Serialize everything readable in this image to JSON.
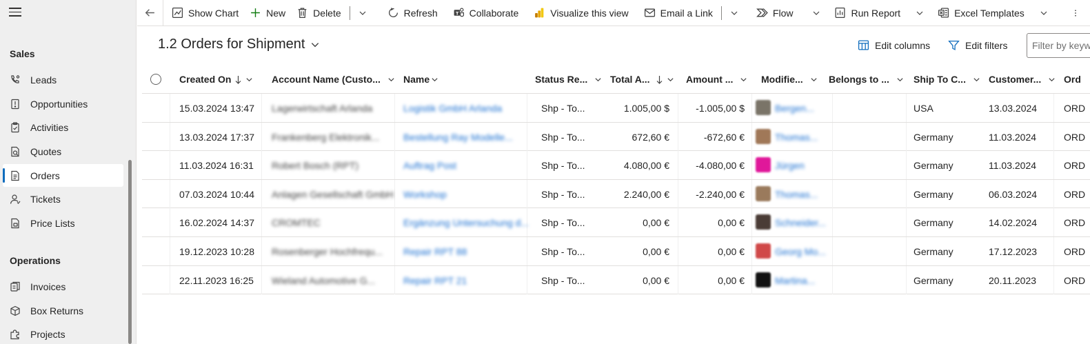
{
  "sidebar": {
    "sections": [
      {
        "title": "Sales",
        "items": [
          {
            "label": "Leads",
            "icon": "phone-person-icon"
          },
          {
            "label": "Opportunities",
            "icon": "opportunity-icon"
          },
          {
            "label": "Activities",
            "icon": "clipboard-icon"
          },
          {
            "label": "Quotes",
            "icon": "quote-icon"
          },
          {
            "label": "Orders",
            "icon": "order-icon",
            "active": true
          },
          {
            "label": "Tickets",
            "icon": "person-icon"
          },
          {
            "label": "Price Lists",
            "icon": "price-list-icon"
          }
        ]
      },
      {
        "title": "Operations",
        "items": [
          {
            "label": "Invoices",
            "icon": "invoice-icon"
          },
          {
            "label": "Box Returns",
            "icon": "box-icon"
          },
          {
            "label": "Projects",
            "icon": "puzzle-icon"
          }
        ]
      }
    ]
  },
  "toolbar": {
    "show_chart": "Show Chart",
    "new": "New",
    "delete": "Delete",
    "refresh": "Refresh",
    "collaborate": "Collaborate",
    "visualize": "Visualize this view",
    "email_link": "Email a Link",
    "flow": "Flow",
    "run_report": "Run Report",
    "excel_templates": "Excel Templates"
  },
  "view": {
    "title": "1.2 Orders for Shipment",
    "edit_columns": "Edit columns",
    "edit_filters": "Edit filters",
    "filter_placeholder": "Filter by keyword"
  },
  "columns": [
    {
      "label": "Created On",
      "sorted": "desc"
    },
    {
      "label": "Account Name (Custo..."
    },
    {
      "label": "Name"
    },
    {
      "label": "Status Re..."
    },
    {
      "label": "Total A...",
      "sorted": "desc"
    },
    {
      "label": "Amount ..."
    },
    {
      "label": "Modifie..."
    },
    {
      "label": "Belongs to ..."
    },
    {
      "label": "Ship To C..."
    },
    {
      "label": "Customer..."
    },
    {
      "label": "Ord"
    }
  ],
  "rows": [
    {
      "created": "15.03.2024 13:47",
      "account": "Lagerwirtschaft Arlanda",
      "name": "Logistik GmbH Arlanda",
      "status": "Shp - To...",
      "total": "1.005,00 $",
      "amount": "-1.005,00 $",
      "modified": "Bergen...",
      "avatar": "#7a7468",
      "ship_to": "USA",
      "customer_date": "13.03.2024",
      "order": "ORD"
    },
    {
      "created": "13.03.2024 17:37",
      "account": "Frankenberg Elektronik...",
      "name": "Bestellung Ray Modelle...",
      "status": "Shp - To...",
      "total": "672,60 €",
      "amount": "-672,60 €",
      "modified": "Thomas...",
      "avatar": "#a07858",
      "ship_to": "Germany",
      "customer_date": "11.03.2024",
      "order": "ORD"
    },
    {
      "created": "11.03.2024 16:31",
      "account": "Robert Bosch (RPT)",
      "name": "Auftrag Post",
      "status": "Shp - To...",
      "total": "4.080,00 €",
      "amount": "-4.080,00 €",
      "modified": "Jürgen",
      "avatar": "#e0189a",
      "ship_to": "Germany",
      "customer_date": "11.03.2024",
      "order": "ORD"
    },
    {
      "created": "07.03.2024 10:44",
      "account": "Anlagen Gesellschaft GmbH",
      "name": "Workshop",
      "status": "Shp - To...",
      "total": "2.240,00 €",
      "amount": "-2.240,00 €",
      "modified": "Thomas...",
      "avatar": "#9a7a5c",
      "ship_to": "Germany",
      "customer_date": "06.03.2024",
      "order": "ORD"
    },
    {
      "created": "16.02.2024 14:37",
      "account": "CROMTEC",
      "name": "Ergänzung Untersuchung d...",
      "status": "Shp - To...",
      "total": "0,00 €",
      "amount": "0,00 €",
      "modified": "Schneider...",
      "avatar": "#4a3c36",
      "ship_to": "Germany",
      "customer_date": "14.02.2024",
      "order": "ORD"
    },
    {
      "created": "19.12.2023 10:28",
      "account": "Rosenberger Hochfrequ...",
      "name": "Repair RPT 88",
      "status": "Shp - To...",
      "total": "0,00 €",
      "amount": "0,00 €",
      "modified": "Georg Mo...",
      "avatar": "#d04848",
      "ship_to": "Germany",
      "customer_date": "17.12.2023",
      "order": "ORD"
    },
    {
      "created": "22.11.2023 16:25",
      "account": "Wieland Automotive G...",
      "name": "Repair RPT 21",
      "status": "Shp - To...",
      "total": "0,00 €",
      "amount": "0,00 €",
      "modified": "Martina...",
      "avatar": "#111111",
      "ship_to": "Germany",
      "customer_date": "20.11.2023",
      "order": "ORD"
    }
  ]
}
